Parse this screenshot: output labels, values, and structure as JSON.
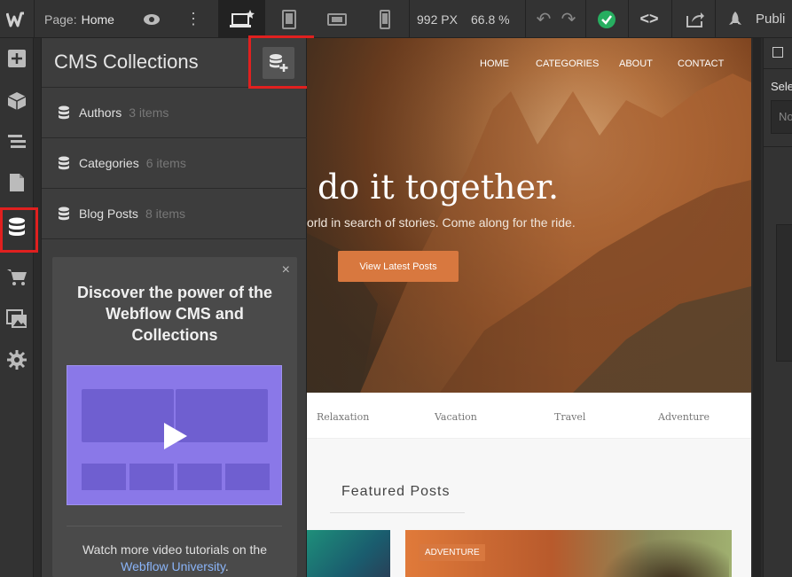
{
  "topbar": {
    "page_label": "Page:",
    "page_name": "Home",
    "width_value": "992 PX",
    "zoom_value": "66.8 %",
    "publish_label": "Publi"
  },
  "cms_panel": {
    "title": "CMS Collections",
    "collections": [
      {
        "name": "Authors",
        "count": "3 items"
      },
      {
        "name": "Categories",
        "count": "6 items"
      },
      {
        "name": "Blog Posts",
        "count": "8 items"
      }
    ],
    "promo": {
      "close_glyph": "×",
      "heading": "Discover the power of the Webflow CMS and Collections",
      "footer_text": "Watch more video tutorials on the",
      "footer_link": "Webflow University",
      "footer_end": "."
    }
  },
  "site": {
    "nav": [
      "HOME",
      "CATEGORIES",
      "ABOUT",
      "CONTACT"
    ],
    "hero_heading": "do it together.",
    "hero_sub": "orld in search of stories. Come along for the ride.",
    "hero_button": "View Latest Posts",
    "tags": [
      "Relaxation",
      "Vacation",
      "Travel",
      "Adventure"
    ],
    "featured_title": "Featured Posts",
    "card_badge": "ADVENTURE"
  },
  "right_panel": {
    "select_label": "Sele",
    "select_value": "No"
  },
  "colors": {
    "accent_green": "#27ae60",
    "highlight_red": "#e0201f",
    "button_orange": "#d8783f",
    "link_blue": "#8ab4f8"
  }
}
